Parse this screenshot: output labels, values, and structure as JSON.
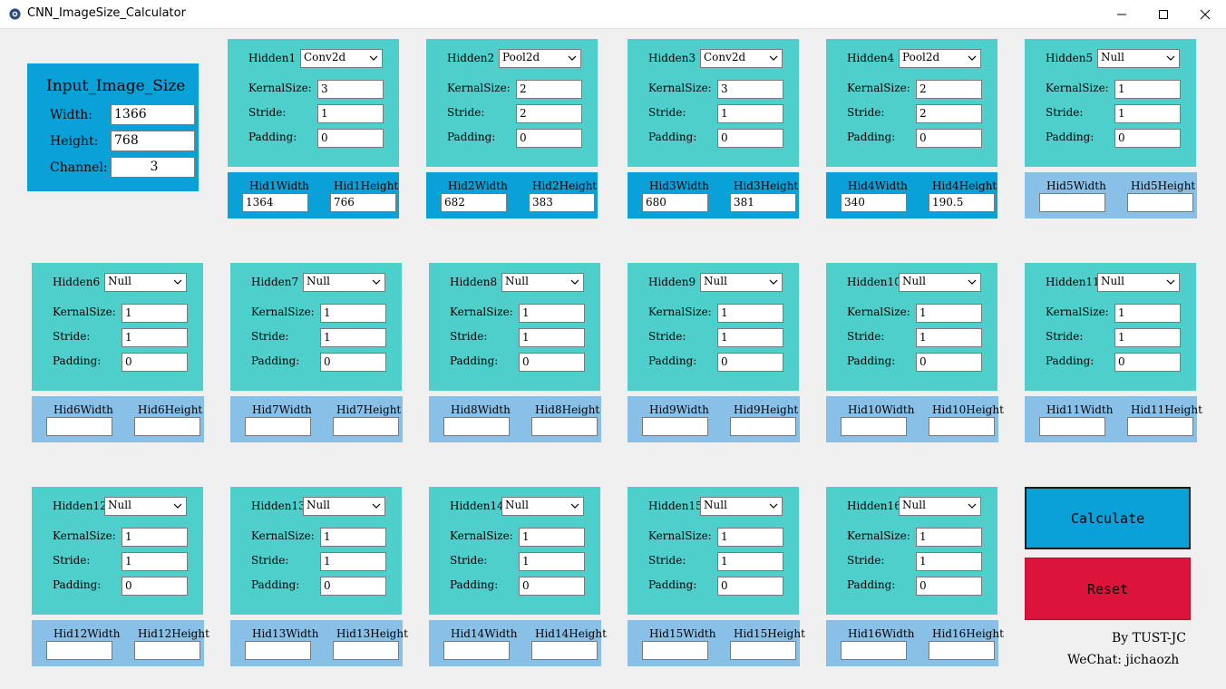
{
  "window": {
    "title": "CNN_ImageSize_Calculator",
    "icon": "app-gear-icon"
  },
  "colors": {
    "teal": "#4ecfcc",
    "blue": "#0aa0d8",
    "light_blue": "#89c0e8",
    "calculate": "#0aa0d8",
    "reset": "#dc143c"
  },
  "input": {
    "title": "Input_Image_Size",
    "width_label": "Width:",
    "width_value": "1366",
    "height_label": "Height:",
    "height_value": "768",
    "channel_label": "Channel:",
    "channel_value": "3"
  },
  "labels": {
    "kernel": "KernalSize:",
    "stride": "Stride:",
    "padding": "Padding:"
  },
  "layers": [
    {
      "name": "Hidden1",
      "type": "Conv2d",
      "kernel": "3",
      "stride": "1",
      "padding": "0",
      "w_label": "Hid1Width",
      "h_label": "Hid1Height",
      "w": "1364",
      "h": "766",
      "computed": true
    },
    {
      "name": "Hidden2",
      "type": "Pool2d",
      "kernel": "2",
      "stride": "2",
      "padding": "0",
      "w_label": "Hid2Width",
      "h_label": "Hid2Height",
      "w": "682",
      "h": "383",
      "computed": true
    },
    {
      "name": "Hidden3",
      "type": "Conv2d",
      "kernel": "3",
      "stride": "1",
      "padding": "0",
      "w_label": "Hid3Width",
      "h_label": "Hid3Height",
      "w": "680",
      "h": "381",
      "computed": true
    },
    {
      "name": "Hidden4",
      "type": "Pool2d",
      "kernel": "2",
      "stride": "2",
      "padding": "0",
      "w_label": "Hid4Width",
      "h_label": "Hid4Height",
      "w": "340",
      "h": "190.5",
      "computed": true
    },
    {
      "name": "Hidden5",
      "type": "Null",
      "kernel": "1",
      "stride": "1",
      "padding": "0",
      "w_label": "Hid5Width",
      "h_label": "Hid5Height",
      "w": "",
      "h": "",
      "computed": false
    },
    {
      "name": "Hidden6",
      "type": "Null",
      "kernel": "1",
      "stride": "1",
      "padding": "0",
      "w_label": "Hid6Width",
      "h_label": "Hid6Height",
      "w": "",
      "h": "",
      "computed": false
    },
    {
      "name": "Hidden7",
      "type": "Null",
      "kernel": "1",
      "stride": "1",
      "padding": "0",
      "w_label": "Hid7Width",
      "h_label": "Hid7Height",
      "w": "",
      "h": "",
      "computed": false
    },
    {
      "name": "Hidden8",
      "type": "Null",
      "kernel": "1",
      "stride": "1",
      "padding": "0",
      "w_label": "Hid8Width",
      "h_label": "Hid8Height",
      "w": "",
      "h": "",
      "computed": false
    },
    {
      "name": "Hidden9",
      "type": "Null",
      "kernel": "1",
      "stride": "1",
      "padding": "0",
      "w_label": "Hid9Width",
      "h_label": "Hid9Height",
      "w": "",
      "h": "",
      "computed": false
    },
    {
      "name": "Hidden10",
      "type": "Null",
      "kernel": "1",
      "stride": "1",
      "padding": "0",
      "w_label": "Hid10Width",
      "h_label": "Hid10Height",
      "w": "",
      "h": "",
      "computed": false
    },
    {
      "name": "Hidden11",
      "type": "Null",
      "kernel": "1",
      "stride": "1",
      "padding": "0",
      "w_label": "Hid11Width",
      "h_label": "Hid11Height",
      "w": "",
      "h": "",
      "computed": false
    },
    {
      "name": "Hidden12",
      "type": "Null",
      "kernel": "1",
      "stride": "1",
      "padding": "0",
      "w_label": "Hid12Width",
      "h_label": "Hid12Height",
      "w": "",
      "h": "",
      "computed": false
    },
    {
      "name": "Hidden13",
      "type": "Null",
      "kernel": "1",
      "stride": "1",
      "padding": "0",
      "w_label": "Hid13Width",
      "h_label": "Hid13Height",
      "w": "",
      "h": "",
      "computed": false
    },
    {
      "name": "Hidden14",
      "type": "Null",
      "kernel": "1",
      "stride": "1",
      "padding": "0",
      "w_label": "Hid14Width",
      "h_label": "Hid14Height",
      "w": "",
      "h": "",
      "computed": false
    },
    {
      "name": "Hidden15",
      "type": "Null",
      "kernel": "1",
      "stride": "1",
      "padding": "0",
      "w_label": "Hid15Width",
      "h_label": "Hid15Height",
      "w": "",
      "h": "",
      "computed": false
    },
    {
      "name": "Hidden16",
      "type": "Null",
      "kernel": "1",
      "stride": "1",
      "padding": "0",
      "w_label": "Hid16Width",
      "h_label": "Hid16Height",
      "w": "",
      "h": "",
      "computed": false
    }
  ],
  "buttons": {
    "calculate": "Calculate",
    "reset": "Reset"
  },
  "footer": {
    "by": "By TUST-JC",
    "wechat": "WeChat: jichaozh"
  }
}
